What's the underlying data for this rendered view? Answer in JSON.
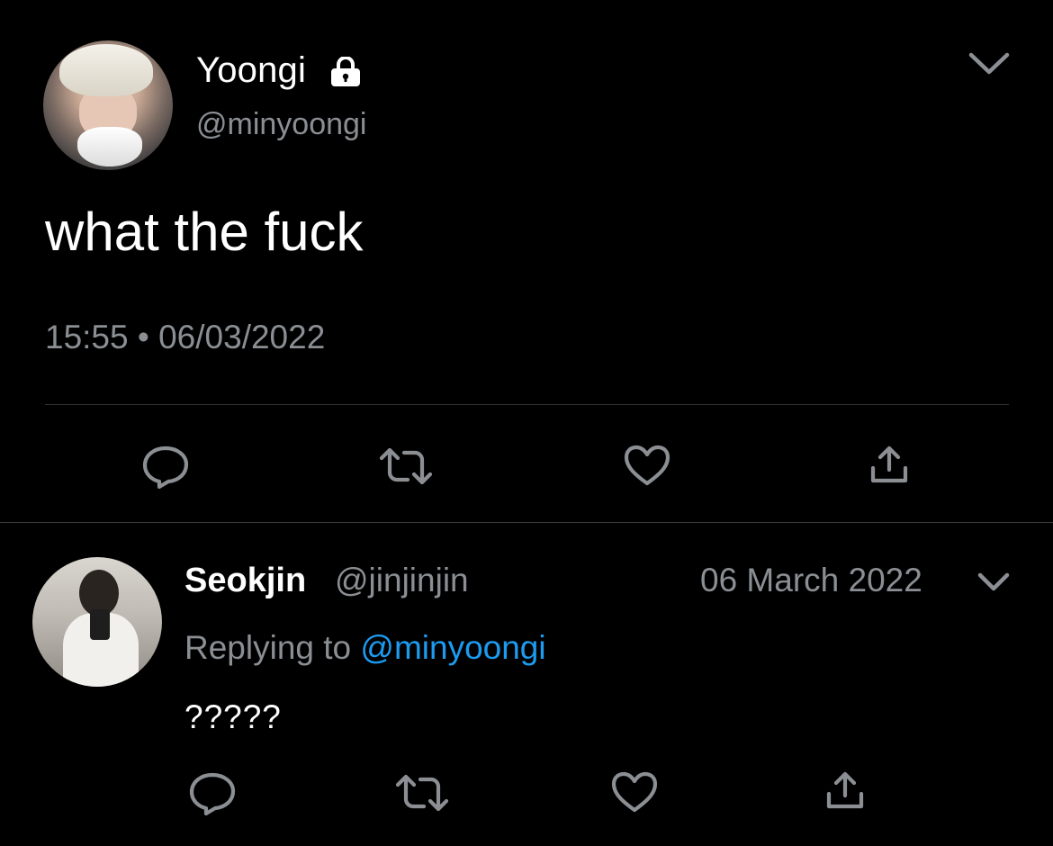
{
  "main_tweet": {
    "author_name": "Yoongi",
    "handle": "@minyoongi",
    "text": "what the fuck",
    "timestamp": "15:55 • 06/03/2022",
    "locked": true
  },
  "reply": {
    "author_name": "Seokjin",
    "handle": "@jinjinjin",
    "date": "06 March 2022",
    "replying_prefix": "Replying to",
    "replying_mention": "@minyoongi",
    "text": "?????"
  },
  "icons": {
    "reply": "reply-icon",
    "retweet": "retweet-icon",
    "like": "heart-icon",
    "share": "share-icon",
    "menu": "chevron-down-icon",
    "lock": "lock-icon"
  },
  "colors": {
    "background": "#000000",
    "text": "#ffffff",
    "secondary_text": "#8b8f94",
    "link": "#1d9bf0",
    "divider": "#2f3336",
    "icon": "#8b8f94"
  }
}
